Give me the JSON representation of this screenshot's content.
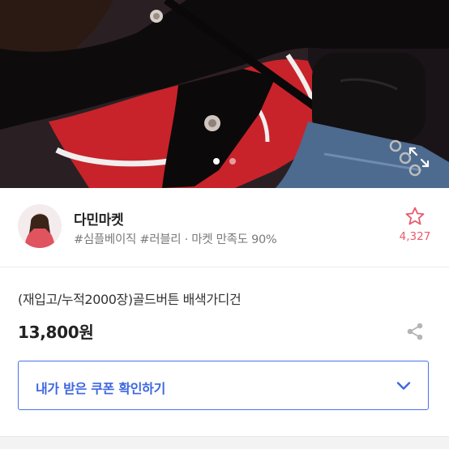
{
  "gallery": {
    "image_alt": "product photo: red and white cardigan with black collar and gold buttons",
    "slide_count": 2,
    "active_slide": 1,
    "expand_icon": "expand-arrows-icon"
  },
  "seller": {
    "name": "다민마켓",
    "meta": "#심플베이직 #러블리 · 마켓 만족도 90%",
    "favorite_icon": "star-outline-icon",
    "favorite_count": "4,327",
    "accent_color": "#e85a6c"
  },
  "product": {
    "title": "(재입고/누적2000장)골드버튼 배색가디건",
    "price": "13,800원",
    "share_icon": "share-icon"
  },
  "coupon": {
    "label": "내가 받은 쿠폰 확인하기",
    "chevron_icon": "chevron-down-icon",
    "accent_color": "#3d67e0"
  }
}
